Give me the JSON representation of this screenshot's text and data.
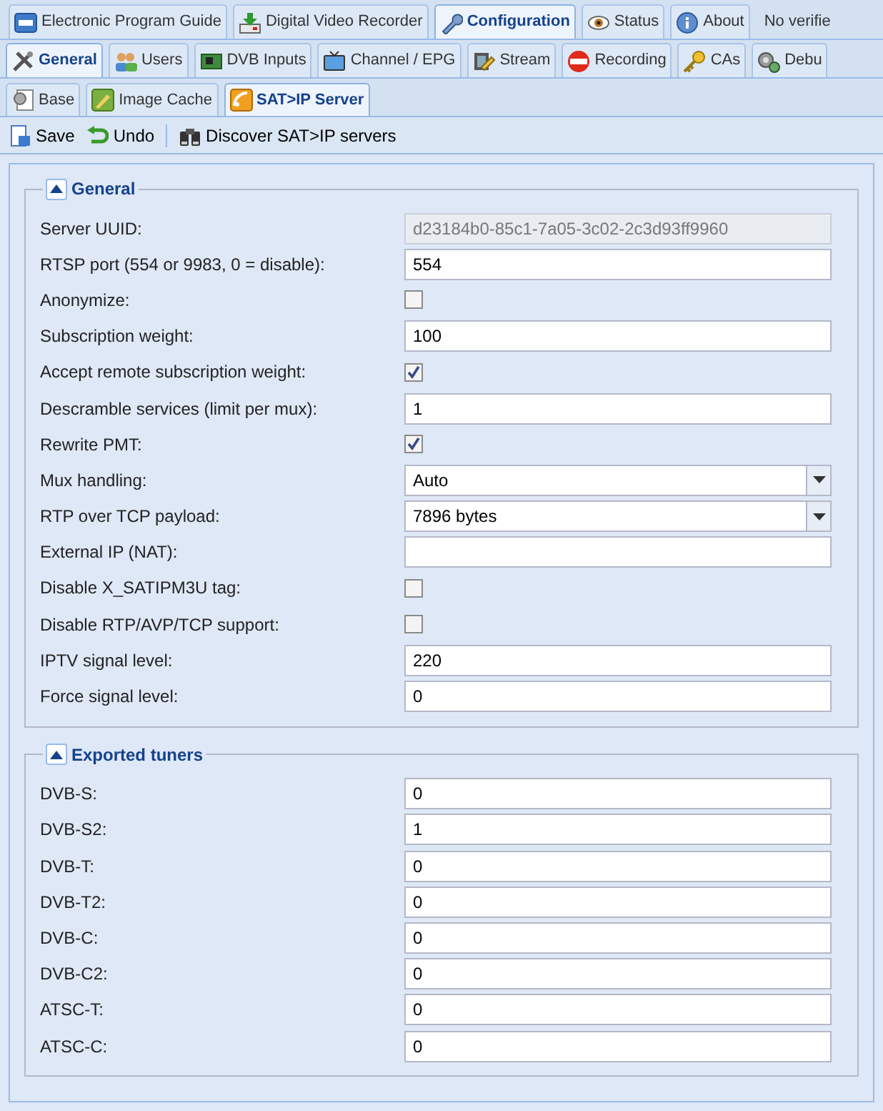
{
  "main_tabs": [
    {
      "label": "Electronic Program Guide",
      "selected": false
    },
    {
      "label": "Digital Video Recorder",
      "selected": false
    },
    {
      "label": "Configuration",
      "selected": true
    },
    {
      "label": "Status",
      "selected": false
    },
    {
      "label": "About",
      "selected": false
    }
  ],
  "status_text": "No verifie",
  "config_tabs": [
    {
      "label": "General",
      "selected": true
    },
    {
      "label": "Users",
      "selected": false
    },
    {
      "label": "DVB Inputs",
      "selected": false
    },
    {
      "label": "Channel / EPG",
      "selected": false
    },
    {
      "label": "Stream",
      "selected": false
    },
    {
      "label": "Recording",
      "selected": false
    },
    {
      "label": "CAs",
      "selected": false
    },
    {
      "label": "Debu",
      "selected": false
    }
  ],
  "general_tabs": [
    {
      "label": "Base",
      "selected": false
    },
    {
      "label": "Image Cache",
      "selected": false
    },
    {
      "label": "SAT>IP Server",
      "selected": true
    }
  ],
  "toolbar": {
    "save": "Save",
    "undo": "Undo",
    "discover": "Discover SAT>IP servers"
  },
  "sections": [
    {
      "title": "General",
      "expanded": true,
      "fields": [
        {
          "label": "Server UUID:",
          "kind": "text",
          "value": "d23184b0-85c1-7a05-3c02-2c3d93ff9960",
          "disabled": true
        },
        {
          "label": "RTSP port (554 or 9983, 0 = disable):",
          "kind": "text",
          "value": "554",
          "disabled": false
        },
        {
          "label": "Anonymize:",
          "kind": "checkbox",
          "checked": false
        },
        {
          "label": "Subscription weight:",
          "kind": "text",
          "value": "100",
          "disabled": false
        },
        {
          "label": "Accept remote subscription weight:",
          "kind": "checkbox",
          "checked": true
        },
        {
          "label": "Descramble services (limit per mux):",
          "kind": "text",
          "value": "1",
          "disabled": false
        },
        {
          "label": "Rewrite PMT:",
          "kind": "checkbox",
          "checked": true
        },
        {
          "label": "Mux handling:",
          "kind": "select",
          "value": "Auto"
        },
        {
          "label": "RTP over TCP payload:",
          "kind": "select",
          "value": "7896 bytes"
        },
        {
          "label": "External IP (NAT):",
          "kind": "text",
          "disabled": false
        },
        {
          "label": "Disable X_SATIPM3U tag:",
          "kind": "checkbox",
          "checked": false
        },
        {
          "label": "Disable RTP/AVP/TCP support:",
          "kind": "checkbox",
          "checked": false
        },
        {
          "label": "IPTV signal level:",
          "kind": "text",
          "value": "220",
          "disabled": false
        },
        {
          "label": "Force signal level:",
          "kind": "text",
          "value": "0",
          "disabled": false
        }
      ]
    },
    {
      "title": "Exported tuners",
      "expanded": true,
      "fields": [
        {
          "label": "DVB-S:",
          "kind": "text",
          "value": "0",
          "disabled": false
        },
        {
          "label": "DVB-S2:",
          "kind": "text",
          "value": "1",
          "disabled": false
        },
        {
          "label": "DVB-T:",
          "kind": "text",
          "value": "0",
          "disabled": false
        },
        {
          "label": "DVB-T2:",
          "kind": "text",
          "value": "0",
          "disabled": false
        },
        {
          "label": "DVB-C:",
          "kind": "text",
          "value": "0",
          "disabled": false
        },
        {
          "label": "DVB-C2:",
          "kind": "text",
          "value": "0",
          "disabled": false
        },
        {
          "label": "ATSC-T:",
          "kind": "text",
          "value": "0",
          "disabled": false
        },
        {
          "label": "ATSC-C:",
          "kind": "text",
          "value": "0",
          "disabled": false
        }
      ]
    }
  ]
}
